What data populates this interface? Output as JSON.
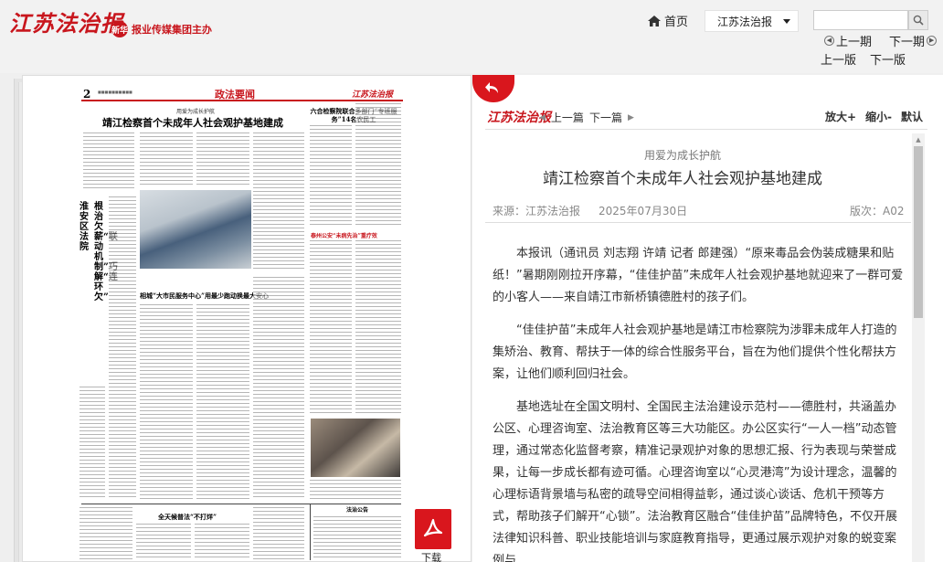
{
  "header": {
    "logo_text": "江苏法治报",
    "group_badge": "新华",
    "group_text": "报业传媒集团主办",
    "home_label": "首页",
    "paper_select_value": "江苏法治报",
    "search_placeholder": "",
    "prev_issue": "上一期",
    "next_issue": "下一期",
    "prev_page": "上一版",
    "next_page": "下一版"
  },
  "newspaper": {
    "page_num": "2",
    "section_title": "政法要闻",
    "masthead": "江苏法治报",
    "kicker": "用爱为成长护航",
    "headline": "靖江检察首个未成年人社会观护基地建成",
    "side_headline": "六合检察院联合多部门“专班服务”14名农民工",
    "vertical_head_1": "淮安区法院",
    "vertical_head_2": "根治欠薪“联动机制”巧解“连环欠”",
    "mid_headline": "相城“大市民服务中心”用最少跑动换最大安心",
    "red_headline": "泰州公安“未病先治”重疗效",
    "bottom_headline": "全天候普法“不打烊”",
    "bottom_right": "法治公告",
    "download_label": "下载"
  },
  "reader": {
    "masthead": "江苏法治报",
    "prev_article": "上一篇",
    "next_article": "下一篇",
    "zoom_in": "放大+",
    "zoom_out": "缩小-",
    "zoom_default": "默认",
    "kicker": "用爱为成长护航",
    "title": "靖江检察首个未成年人社会观护基地建成",
    "source": "来源：江苏法治报",
    "date": "2025年07月30日",
    "edition": "版次：A02",
    "paragraphs": [
      "本报讯（通讯员 刘志翔 许靖 记者 郎建强）“原来毒品会伪装成糖果和贴纸！”暑期刚刚拉开序幕，“佳佳护苗”未成年人社会观护基地就迎来了一群可爱的小客人——来自靖江市新桥镇德胜村的孩子们。",
      "“佳佳护苗”未成年人社会观护基地是靖江市检察院为涉罪未成年人打造的集矫治、教育、帮扶于一体的综合性服务平台，旨在为他们提供个性化帮扶方案，让他们顺利回归社会。",
      "基地选址在全国文明村、全国民主法治建设示范村——德胜村，共涵盖办公区、心理咨询室、法治教育区等三大功能区。办公区实行“一人一档”动态管理，通过常态化监督考察，精准记录观护对象的思想汇报、行为表现与荣誉成果，让每一步成长都有迹可循。心理咨询室以“心灵港湾”为设计理念，温馨的心理标语背景墙与私密的疏导空间相得益彰，通过谈心谈话、危机干预等方式，帮助孩子们解开“心锁”。法治教育区融合“佳佳护苗”品牌特色，不仅开展法律知识科普、职业技能培训与家庭教育指导，更通过展示观护对象的蜕变案例与"
    ]
  },
  "colors": {
    "brand_red": "#c8161d",
    "download_red": "#d9161d"
  }
}
